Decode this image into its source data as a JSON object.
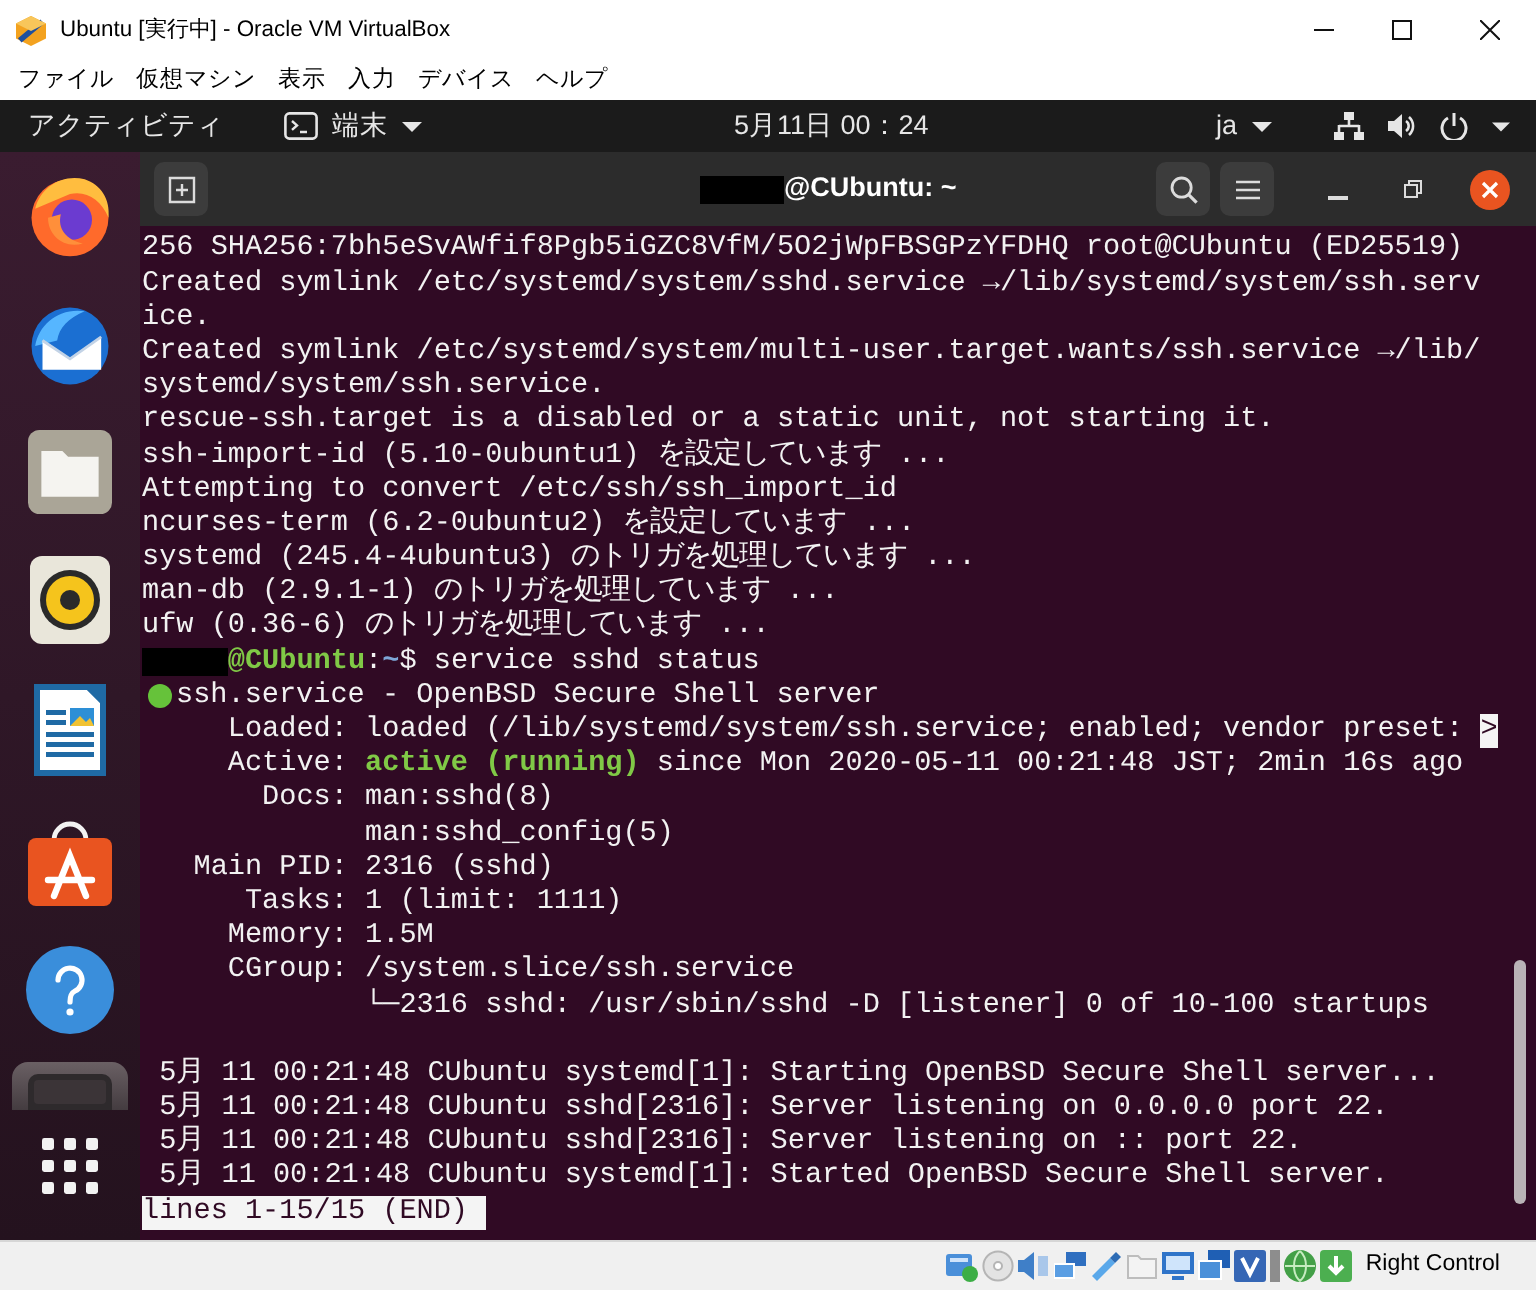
{
  "window": {
    "title": "Ubuntu [実行中] - Oracle VM VirtualBox"
  },
  "menu": [
    "ファイル",
    "仮想マシン",
    "表示",
    "入力",
    "デバイス",
    "ヘルプ"
  ],
  "top_bar": {
    "activities": "アクティビティ",
    "app_menu": "端末",
    "clock": "5月11日 00：24",
    "input_method": "ja"
  },
  "dock": [
    {
      "kind": "firefox",
      "running": false
    },
    {
      "kind": "thunderbird",
      "running": false
    },
    {
      "kind": "files",
      "running": false
    },
    {
      "kind": "rhythmbox",
      "running": false
    },
    {
      "kind": "writer",
      "running": false
    },
    {
      "kind": "software",
      "running": false
    },
    {
      "kind": "help",
      "running": false
    },
    {
      "kind": "terminal",
      "running": true
    }
  ],
  "terminal": {
    "title": "@CUbuntu: ~",
    "title_redacted": true,
    "lines": [
      {
        "kind": "text",
        "text": "256 SHA256:7bh5eSvAWfif8Pgb5iGZC8VfM/5O2jWpFBSGPzYFDHQ root@CUbuntu (ED25519)"
      },
      {
        "kind": "text",
        "text": "Created symlink /etc/systemd/system/sshd.service →/lib/systemd/system/ssh.serv"
      },
      {
        "kind": "text",
        "text": "ice."
      },
      {
        "kind": "text",
        "text": "Created symlink /etc/systemd/system/multi-user.target.wants/ssh.service →/lib/"
      },
      {
        "kind": "text",
        "text": "systemd/system/ssh.service."
      },
      {
        "kind": "text",
        "text": "rescue-ssh.target is a disabled or a static unit, not starting it."
      },
      {
        "kind": "text",
        "text": "ssh-import-id (5.10-0ubuntu1) を設定しています ..."
      },
      {
        "kind": "text",
        "text": "Attempting to convert /etc/ssh/ssh_import_id"
      },
      {
        "kind": "text",
        "text": "ncurses-term (6.2-0ubuntu2) を設定しています ..."
      },
      {
        "kind": "text",
        "text": "systemd (245.4-4ubuntu3) のトリガを処理しています ..."
      },
      {
        "kind": "text",
        "text": "man-db (2.9.1-1) のトリガを処理しています ..."
      },
      {
        "kind": "text",
        "text": "ufw (0.36-6) のトリガを処理しています ..."
      },
      {
        "kind": "prompt",
        "redacted": true,
        "parts": [
          {
            "kind": "host",
            "text": "@CUbuntu"
          },
          {
            "kind": "plain",
            "text": ":"
          },
          {
            "kind": "path",
            "text": "~"
          },
          {
            "kind": "plain",
            "text": "$ service sshd status"
          }
        ]
      },
      {
        "kind": "unit",
        "active": true,
        "text": "ssh.service - OpenBSD Secure Shell server"
      },
      {
        "kind": "field",
        "label": "Loaded:",
        "value": "loaded (/lib/systemd/system/ssh.service; enabled; vendor preset:",
        "marker": ">"
      },
      {
        "kind": "field",
        "label": "Active:",
        "value": "**active (running)** since Mon 2020-05-11 00:21:48 JST; 2min 16s ago"
      },
      {
        "kind": "field",
        "label": "Docs:",
        "value": "man:sshd(8)"
      },
      {
        "kind": "field",
        "value": "man:sshd_config(5)"
      },
      {
        "kind": "field",
        "label": "Main PID:",
        "value": "2316 (sshd)"
      },
      {
        "kind": "field",
        "label": "Tasks:",
        "value": "1 (limit: 1111)"
      },
      {
        "kind": "field",
        "label": "Memory:",
        "value": "1.5M"
      },
      {
        "kind": "field",
        "label": "CGroup:",
        "value": "/system.slice/ssh.service"
      },
      {
        "kind": "field",
        "value": "└─2316 sshd: /usr/sbin/sshd -D [listener] 0 of 10-100 startups"
      },
      {
        "kind": "blank"
      },
      {
        "kind": "journal",
        "text": "5月 11 00:21:48 CUbuntu systemd[1]: Starting OpenBSD Secure Shell server..."
      },
      {
        "kind": "journal",
        "text": "5月 11 00:21:48 CUbuntu sshd[2316]: Server listening on 0.0.0.0 port 22."
      },
      {
        "kind": "journal",
        "text": "5月 11 00:21:48 CUbuntu sshd[2316]: Server listening on :: port 22."
      },
      {
        "kind": "journal",
        "text": "5月 11 00:21:48 CUbuntu systemd[1]: Started OpenBSD Secure Shell server."
      },
      {
        "kind": "pager",
        "text": "lines 1-15/15 (END)"
      }
    ]
  },
  "status_bar": {
    "devices": [
      {
        "kind": "disk"
      },
      {
        "kind": "disc"
      },
      {
        "kind": "audio"
      },
      {
        "kind": "network"
      },
      {
        "kind": "usb"
      },
      {
        "kind": "shared"
      },
      {
        "kind": "display"
      },
      {
        "kind": "capture"
      },
      {
        "kind": "vtile"
      },
      {
        "kind": "bar"
      },
      {
        "kind": "globe"
      },
      {
        "kind": "arrow"
      }
    ],
    "host_key": "Right Control"
  }
}
